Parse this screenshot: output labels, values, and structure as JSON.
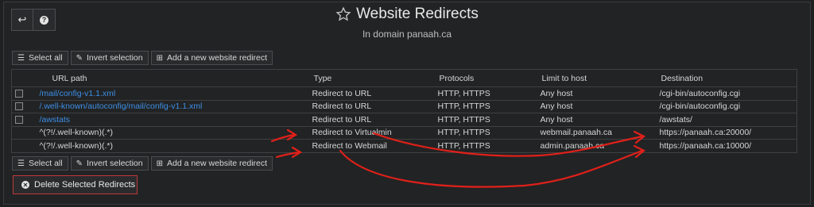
{
  "header": {
    "back_icon": "return-arrow-icon",
    "help_icon": "help-icon",
    "star_icon": "star-icon",
    "title": "Website Redirects",
    "subtitle": "In domain panaah.ca"
  },
  "toolbar": {
    "select_all": "Select all",
    "invert_selection": "Invert selection",
    "add_redirect": "Add a new website redirect"
  },
  "table": {
    "columns": [
      "URL path",
      "Type",
      "Protocols",
      "Limit to host",
      "Destination"
    ],
    "rows": [
      {
        "checkbox": true,
        "path": "/mail/config-v1.1.xml",
        "path_link": true,
        "type": "Redirect to URL",
        "protocols": "HTTP, HTTPS",
        "host": "Any host",
        "destination": "/cgi-bin/autoconfig.cgi"
      },
      {
        "checkbox": true,
        "path": "/.well-known/autoconfig/mail/config-v1.1.xml",
        "path_link": true,
        "type": "Redirect to URL",
        "protocols": "HTTP, HTTPS",
        "host": "Any host",
        "destination": "/cgi-bin/autoconfig.cgi"
      },
      {
        "checkbox": true,
        "path": "/awstats",
        "path_link": true,
        "type": "Redirect to URL",
        "protocols": "HTTP, HTTPS",
        "host": "Any host",
        "destination": "/awstats/"
      },
      {
        "checkbox": false,
        "path": "^(?!/.well-known)(.*)",
        "path_link": false,
        "type": "Redirect to Virtualmin",
        "protocols": "HTTP, HTTPS",
        "host": "webmail.panaah.ca",
        "destination": "https://panaah.ca:20000/"
      },
      {
        "checkbox": false,
        "path": "^(?!/.well-known)(.*)",
        "path_link": false,
        "type": "Redirect to Webmail",
        "protocols": "HTTP, HTTPS",
        "host": "admin.panaah.ca",
        "destination": "https://panaah.ca:10000/"
      }
    ]
  },
  "delete_button": "Delete Selected Redirects",
  "colors": {
    "link": "#3d8fe6",
    "danger": "#c0393b",
    "annotation": "#e0201a"
  }
}
